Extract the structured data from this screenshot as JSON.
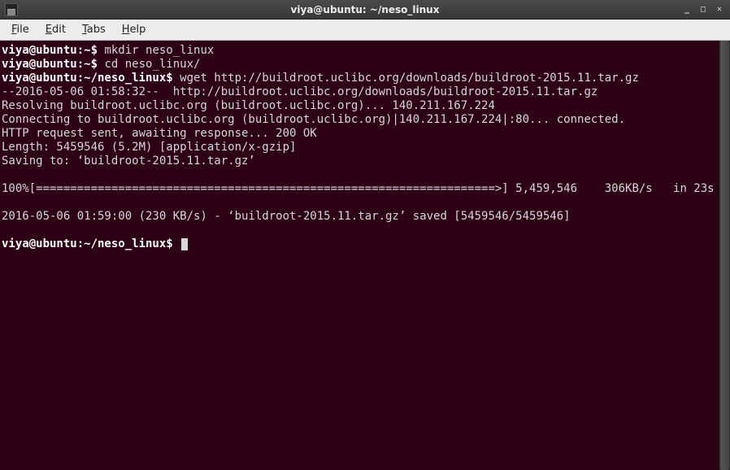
{
  "window": {
    "title": "viya@ubuntu: ~/neso_linux"
  },
  "menubar": {
    "items": [
      {
        "mn": "F",
        "rest": "ile"
      },
      {
        "mn": "E",
        "rest": "dit"
      },
      {
        "mn": "T",
        "rest": "abs"
      },
      {
        "mn": "H",
        "rest": "elp"
      }
    ]
  },
  "terminal": {
    "lines": [
      {
        "prompt": "viya@ubuntu:~$ ",
        "cmd": "mkdir neso_linux"
      },
      {
        "prompt": "viya@ubuntu:~$ ",
        "cmd": "cd neso_linux/"
      },
      {
        "prompt": "viya@ubuntu:~/neso_linux$ ",
        "cmd": "wget http://buildroot.uclibc.org/downloads/buildroot-2015.11.tar.gz"
      },
      {
        "text": "--2016-05-06 01:58:32--  http://buildroot.uclibc.org/downloads/buildroot-2015.11.tar.gz"
      },
      {
        "text": "Resolving buildroot.uclibc.org (buildroot.uclibc.org)... 140.211.167.224"
      },
      {
        "text": "Connecting to buildroot.uclibc.org (buildroot.uclibc.org)|140.211.167.224|:80... connected."
      },
      {
        "text": "HTTP request sent, awaiting response... 200 OK"
      },
      {
        "text": "Length: 5459546 (5.2M) [application/x-gzip]"
      },
      {
        "text": "Saving to: ‘buildroot-2015.11.tar.gz’"
      },
      {
        "text": ""
      },
      {
        "text": "100%[===================================================================>] 5,459,546    306KB/s   in 23s"
      },
      {
        "text": ""
      },
      {
        "text": "2016-05-06 01:59:00 (230 KB/s) - ‘buildroot-2015.11.tar.gz’ saved [5459546/5459546]"
      },
      {
        "text": ""
      },
      {
        "prompt": "viya@ubuntu:~/neso_linux$ ",
        "cmd": "",
        "cursor": true
      }
    ]
  }
}
